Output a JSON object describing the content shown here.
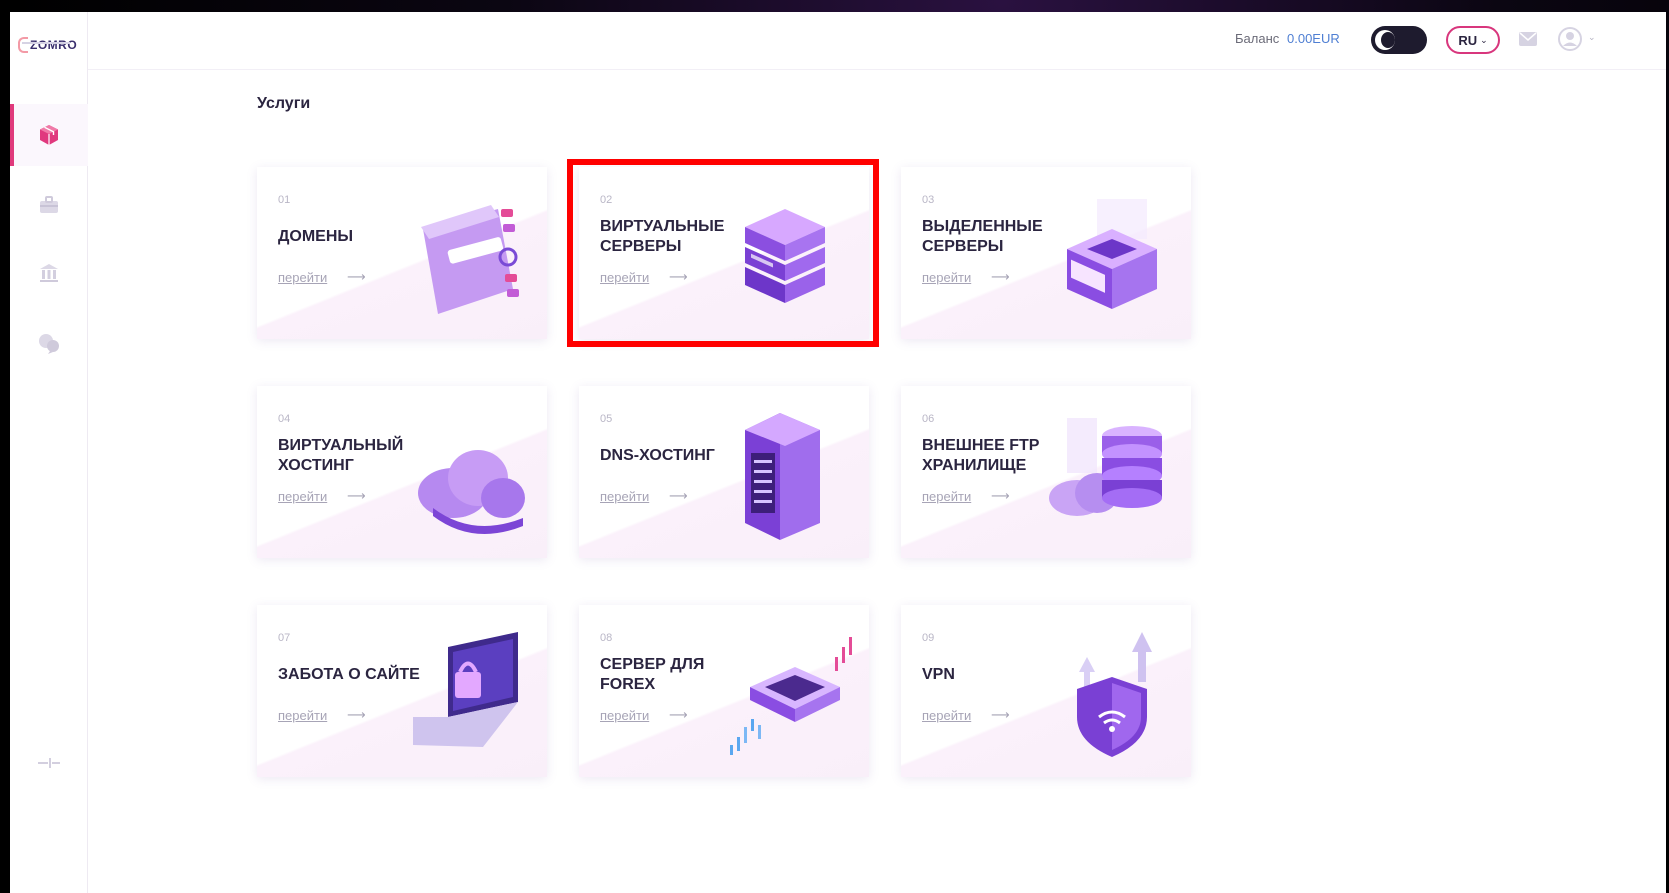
{
  "header": {
    "balance_label": "Баланс",
    "balance_value": "0.00EUR",
    "lang": "RU"
  },
  "logo": {
    "text": "ZOMRO"
  },
  "sidebar": {
    "items": [
      {
        "icon": "box-icon",
        "active": true
      },
      {
        "icon": "briefcase-icon",
        "active": false
      },
      {
        "icon": "bank-icon",
        "active": false
      },
      {
        "icon": "support-chat-icon",
        "active": false
      }
    ],
    "collapse_icon": "collapse-icon"
  },
  "page_title": "Услуги",
  "cards": [
    {
      "num": "01",
      "title": "ДОМЕНЫ",
      "link": "перейти",
      "art": "domain-search-illustration"
    },
    {
      "num": "02",
      "title": "ВИРТУАЛЬНЫЕ СЕРВЕРЫ",
      "link": "перейти",
      "art": "server-stack-illustration"
    },
    {
      "num": "03",
      "title": "ВЫДЕЛЕННЫЕ СЕРВЕРЫ",
      "link": "перейти",
      "art": "dedicated-server-illustration"
    },
    {
      "num": "04",
      "title": "ВИРТУАЛЬНЫЙ ХОСТИНГ",
      "link": "перейти",
      "art": "cloud-illustration"
    },
    {
      "num": "05",
      "title": "DNS-ХОСТИНГ",
      "link": "перейти",
      "art": "server-rack-illustration"
    },
    {
      "num": "06",
      "title": "ВНЕШНЕЕ FTP ХРАНИЛИЩЕ",
      "link": "перейти",
      "art": "database-cloud-illustration"
    },
    {
      "num": "07",
      "title": "ЗАБОТА О САЙТЕ",
      "link": "перейти",
      "art": "laptop-lock-illustration"
    },
    {
      "num": "08",
      "title": "СЕРВЕР ДЛЯ FOREX",
      "link": "перейти",
      "art": "forex-chip-illustration"
    },
    {
      "num": "09",
      "title": "VPN",
      "link": "перейти",
      "art": "vpn-shield-illustration"
    }
  ],
  "highlighted_card": "02",
  "colors": {
    "accent": "#e03a7c",
    "highlight": "#ff0000",
    "purple": "#9b6be6",
    "balance": "#4f7fd3"
  }
}
